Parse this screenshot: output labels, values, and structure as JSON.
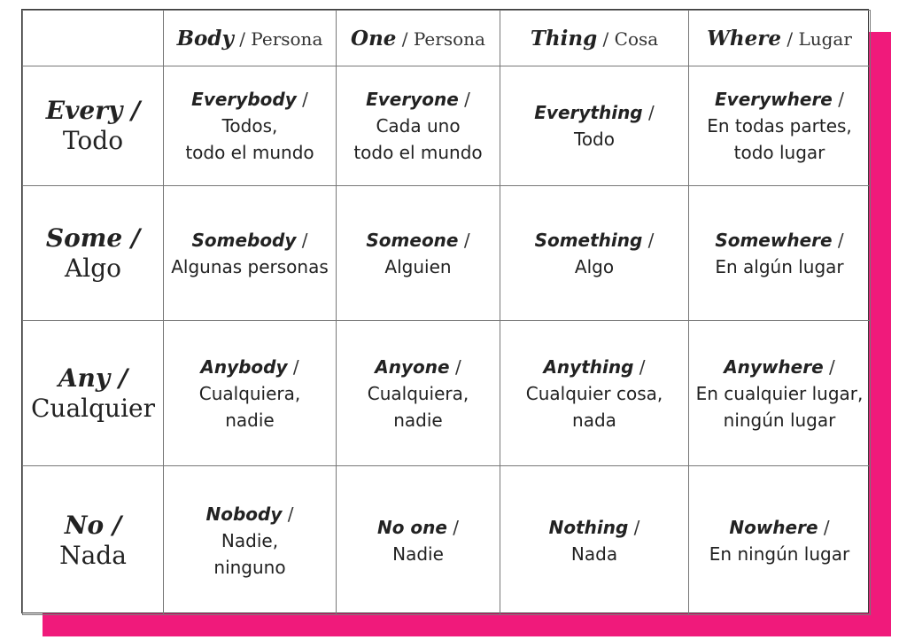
{
  "table": {
    "columns": [
      {
        "en": "Body",
        "sep": " / ",
        "es": "Persona"
      },
      {
        "en": "One",
        "sep": " / ",
        "es": "Persona"
      },
      {
        "en": "Thing",
        "sep": " / ",
        "es": "Cosa"
      },
      {
        "en": "Where",
        "sep": " / ",
        "es": "Lugar"
      }
    ],
    "rows": [
      {
        "en": "Every /",
        "es": "Todo",
        "cells": [
          {
            "en": "Everybody",
            "sep": " /",
            "es": "Todos,\ntodo el mundo"
          },
          {
            "en": "Everyone",
            "sep": " /",
            "es": "Cada uno\ntodo el mundo"
          },
          {
            "en": "Everything",
            "sep": " /",
            "es": "Todo"
          },
          {
            "en": "Everywhere",
            "sep": " /",
            "es": "En todas partes,\ntodo lugar"
          }
        ]
      },
      {
        "en": "Some /",
        "es": "Algo",
        "cells": [
          {
            "en": "Somebody",
            "sep": " /",
            "es": "Algunas personas"
          },
          {
            "en": "Someone",
            "sep": " /",
            "es": "Alguien"
          },
          {
            "en": "Something",
            "sep": " /",
            "es": "Algo"
          },
          {
            "en": "Somewhere",
            "sep": " /",
            "es": "En algún lugar"
          }
        ]
      },
      {
        "en": "Any /",
        "es": "Cualquier",
        "cells": [
          {
            "en": "Anybody",
            "sep": " /",
            "es": "Cualquiera,\nnadie"
          },
          {
            "en": "Anyone",
            "sep": " /",
            "es": "Cualquiera,\nnadie"
          },
          {
            "en": "Anything",
            "sep": " /",
            "es": "Cualquier cosa,\nnada"
          },
          {
            "en": "Anywhere",
            "sep": " /",
            "es": "En cualquier lugar,\nningún lugar"
          }
        ]
      },
      {
        "en": "No /",
        "es": "Nada",
        "cells": [
          {
            "en": "Nobody",
            "sep": " /",
            "es": "Nadie,\nninguno"
          },
          {
            "en": "No one",
            "sep": " /",
            "es": "Nadie"
          },
          {
            "en": "Nothing",
            "sep": " /",
            "es": "Nada"
          },
          {
            "en": "Nowhere",
            "sep": " /",
            "es": "En ningún lugar"
          }
        ]
      }
    ]
  },
  "colors": {
    "accent_shadow": "#f01a7b",
    "border": "#777777",
    "text": "#222222"
  }
}
